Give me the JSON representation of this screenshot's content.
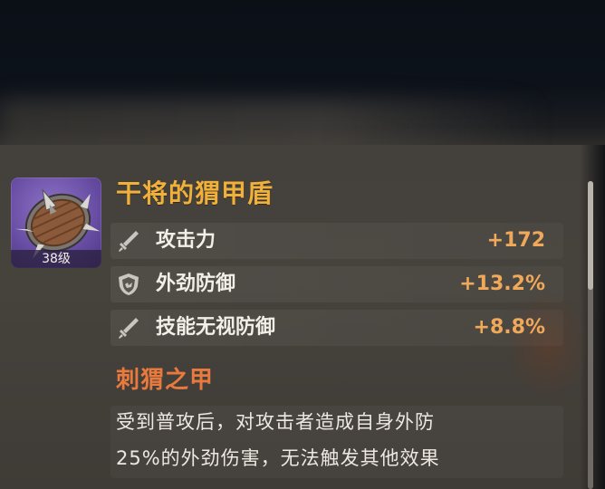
{
  "item": {
    "name": "干将的猬甲盾",
    "level_label": "38级",
    "icon": "spiked-shield-icon"
  },
  "stats": [
    {
      "name": "攻击力",
      "value": "+172",
      "icon": "sword-icon"
    },
    {
      "name": "外劲防御",
      "value": "+13.2%",
      "icon": "shield-icon"
    },
    {
      "name": "技能无视防御",
      "value": "+8.8%",
      "icon": "sword-icon"
    }
  ],
  "skill": {
    "title": "刺猬之甲",
    "description_lines": [
      "受到普攻后，对攻击者造成自身外防",
      "25%的外劲伤害，无法触发其他效果"
    ]
  },
  "colors": {
    "item_name": "#f0b03a",
    "stat_value": "#f0a95a",
    "skill_title": "#e97a3d",
    "icon_bg": "#6a4fa6",
    "panel_bg": "#44403b"
  }
}
